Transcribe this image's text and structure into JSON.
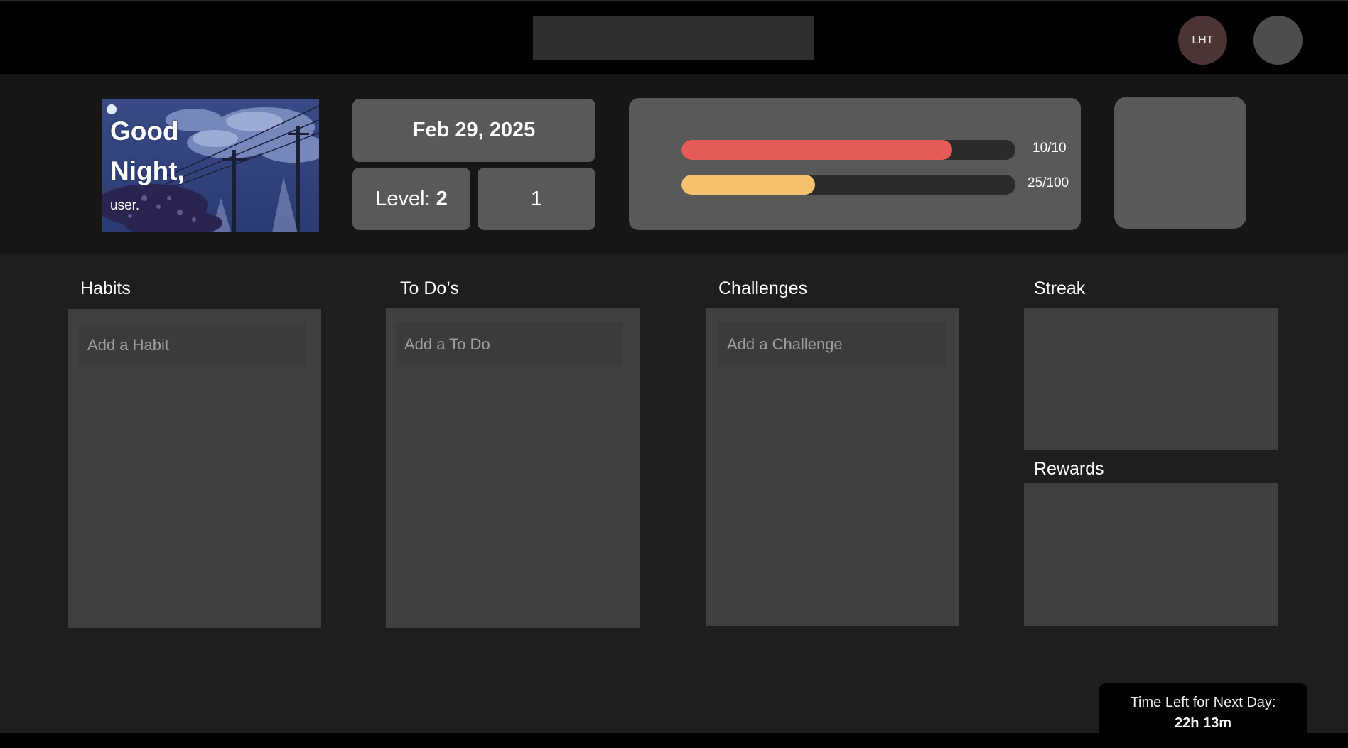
{
  "header": {
    "avatar_initials": "LHT",
    "icons": [
      "search-box",
      "initials-avatar",
      "profile-avatar"
    ]
  },
  "greeting": {
    "line1": "Good",
    "line2": "Night,",
    "user": "user."
  },
  "date": "Feb 29, 2025",
  "level": {
    "label": "Level:",
    "value": "2"
  },
  "count": "1",
  "bars": {
    "health": {
      "text": "10/10",
      "fraction": 0.81,
      "color": "#e55b58"
    },
    "experience": {
      "text": "25/100",
      "fraction": 0.4,
      "color": "#f6c26e"
    }
  },
  "sections": {
    "habits": {
      "title": "Habits",
      "placeholder": "Add a Habit"
    },
    "todos": {
      "title": "To Do’s",
      "placeholder": "Add a To Do"
    },
    "challenges": {
      "title": "Challenges",
      "placeholder": "Add a Challenge"
    },
    "streak": {
      "title": "Streak"
    },
    "rewards": {
      "title": "Rewards"
    }
  },
  "timer": {
    "label": "Time Left for Next Day:",
    "value": "22h 13m"
  }
}
